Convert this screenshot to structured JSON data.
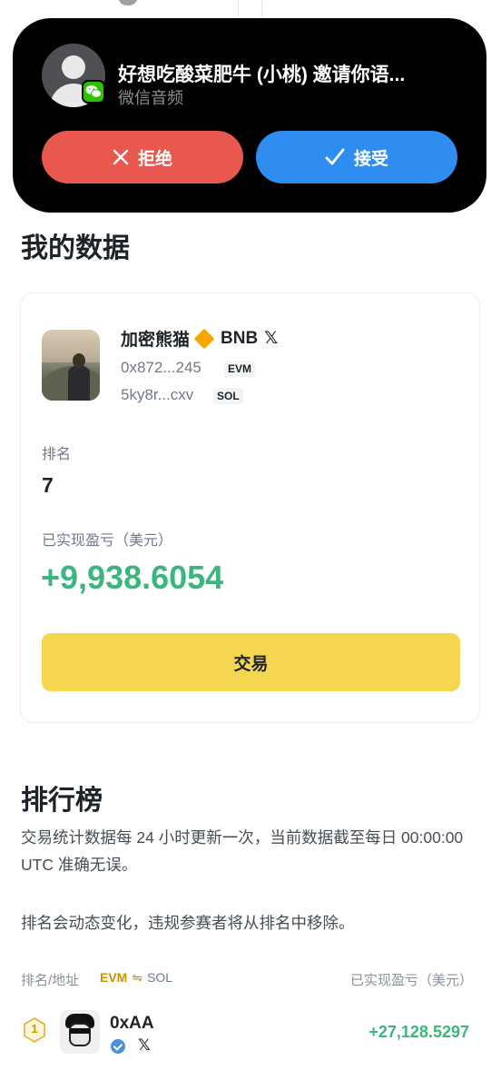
{
  "call": {
    "title": "好想吃酸菜肥牛 (小桃) 邀请你语...",
    "subtitle": "微信音频",
    "decline_label": "拒绝",
    "accept_label": "接受"
  },
  "my_data": {
    "section_title": "我的数据",
    "profile": {
      "name": "加密熊猫",
      "badge": "BNB",
      "evm_address": "0x872...245",
      "evm_tag": "EVM",
      "sol_address": "5ky8r...cxv",
      "sol_tag": "SOL"
    },
    "rank_label": "排名",
    "rank_value": "7",
    "pnl_label": "已实现盈亏（美元）",
    "pnl_value": "+9,938.6054",
    "trade_button": "交易"
  },
  "leaderboard": {
    "section_title": "排行榜",
    "desc1": "交易统计数据每 24 小时更新一次，当前数据截至每日 00:00:00 UTC 准确无误。",
    "desc2": "排名会动态变化，违规参赛者将从排名中移除。",
    "header_rank": "排名/地址",
    "toggle_evm": "EVM",
    "toggle_swap": "⇋",
    "toggle_sol": "SOL",
    "header_pnl": "已实现盈亏（美元）",
    "rows": [
      {
        "rank": "1",
        "name": "0xAA",
        "pnl": "+27,128.5297"
      }
    ]
  },
  "colors": {
    "decline": "#e8584f",
    "accept": "#2f8cf0",
    "trade": "#f5d651",
    "profit": "#3db57f",
    "accent": "#c99400"
  }
}
